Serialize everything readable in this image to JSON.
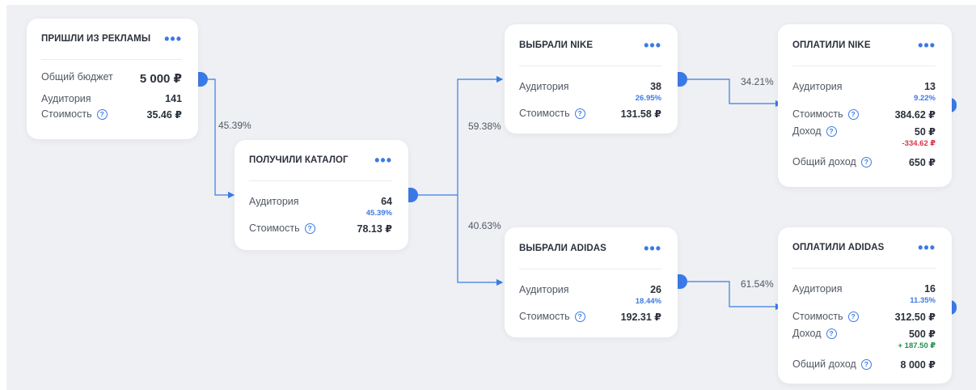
{
  "nodes": {
    "ads": {
      "title": "ПРИШЛИ ИЗ РЕКЛАМЫ",
      "budget_label": "Общий бюджет",
      "budget_value": "5 000 ₽",
      "audience_label": "Аудитория",
      "audience_value": "141",
      "cost_label": "Стоимость",
      "cost_value": "35.46 ₽"
    },
    "catalog": {
      "title": "ПОЛУЧИЛИ КАТАЛОГ",
      "audience_label": "Аудитория",
      "audience_value": "64",
      "audience_pct": "45.39%",
      "cost_label": "Стоимость",
      "cost_value": "78.13 ₽"
    },
    "nike": {
      "title": "ВЫБРАЛИ NIKE",
      "audience_label": "Аудитория",
      "audience_value": "38",
      "audience_pct": "26.95%",
      "cost_label": "Стоимость",
      "cost_value": "131.58 ₽"
    },
    "adidas": {
      "title": "ВЫБРАЛИ ADIDAS",
      "audience_label": "Аудитория",
      "audience_value": "26",
      "audience_pct": "18.44%",
      "cost_label": "Стоимость",
      "cost_value": "192.31 ₽"
    },
    "paid_nike": {
      "title": "ОПЛАТИЛИ NIKE",
      "audience_label": "Аудитория",
      "audience_value": "13",
      "audience_pct": "9.22%",
      "cost_label": "Стоимость",
      "cost_value": "384.62 ₽",
      "income_label": "Доход",
      "income_value": "50 ₽",
      "income_diff": "-334.62 ₽",
      "total_label": "Общий доход",
      "total_value": "650 ₽"
    },
    "paid_adidas": {
      "title": "ОПЛАТИЛИ ADIDAS",
      "audience_label": "Аудитория",
      "audience_value": "16",
      "audience_pct": "11.35%",
      "cost_label": "Стоимость",
      "cost_value": "312.50 ₽",
      "income_label": "Доход",
      "income_value": "500 ₽",
      "income_diff": "+ 187.50 ₽",
      "total_label": "Общий доход",
      "total_value": "8 000 ₽"
    }
  },
  "edges": {
    "ads_catalog": "45.39%",
    "catalog_nike": "59.38%",
    "catalog_adidas": "40.63%",
    "nike_paid": "34.21%",
    "adidas_paid": "61.54%"
  },
  "menu_glyph": "•••",
  "help_glyph": "?",
  "colors": {
    "accent": "#3b7ae6",
    "negative": "#d8344a",
    "positive": "#1f8f4e",
    "canvas": "#eef0f3"
  }
}
